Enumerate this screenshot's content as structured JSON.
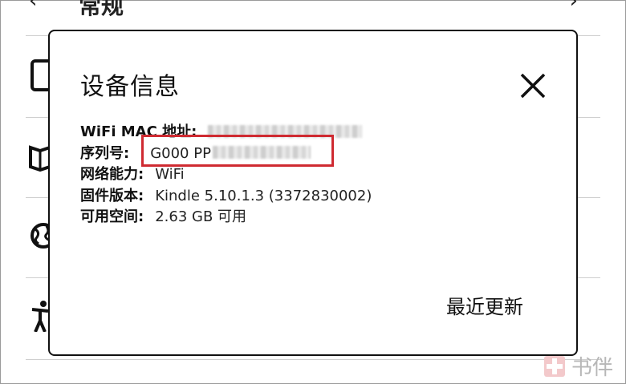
{
  "background": {
    "header_title": "常规",
    "icons": [
      "tablet-icon",
      "book-icon",
      "globe-icon",
      "accessibility-icon"
    ]
  },
  "dialog": {
    "title": "设备信息",
    "fields": [
      {
        "label": "WiFi MAC 地址:",
        "value": ""
      },
      {
        "label": "序列号:",
        "value": "G000 PP"
      },
      {
        "label": "网络能力:",
        "value": "WiFi"
      },
      {
        "label": "固件版本:",
        "value": "Kindle 5.10.1.3 (3372830002)"
      },
      {
        "label": "可用空间:",
        "value": "2.63 GB 可用"
      }
    ],
    "action_label": "最近更新"
  },
  "highlight_color": "#cf2a31",
  "watermark": {
    "text": "书伴"
  }
}
